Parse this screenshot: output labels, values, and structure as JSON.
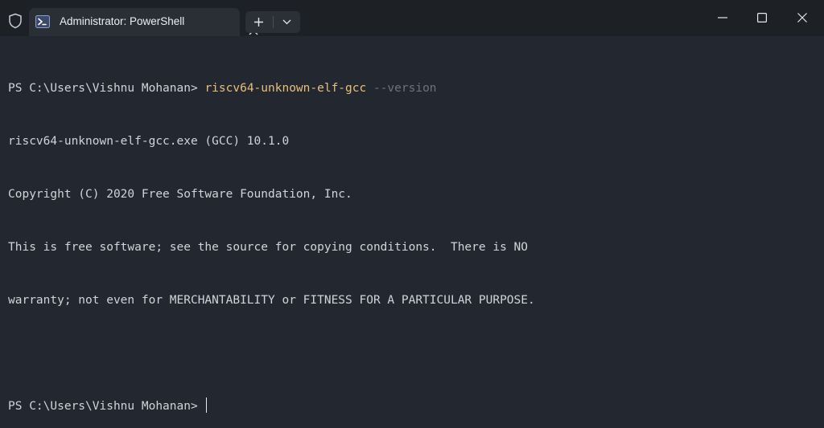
{
  "titlebar": {
    "tab_title": "Administrator: PowerShell",
    "shield_icon": "shield-icon",
    "tab_icon": "powershell-icon",
    "new_tab_icon": "plus-icon",
    "dropdown_icon": "chevron-down-icon",
    "window_controls": [
      "minimize-icon",
      "maximize-icon",
      "close-icon"
    ]
  },
  "terminal": {
    "prompt1": "PS C:\\Users\\Vishnu Mohanan> ",
    "command": "riscv64-unknown-elf-gcc",
    "command_arg": " --version",
    "output": [
      "riscv64-unknown-elf-gcc.exe (GCC) 10.1.0",
      "Copyright (C) 2020 Free Software Foundation, Inc.",
      "This is free software; see the source for copying conditions.  There is NO",
      "warranty; not even for MERCHANTABILITY or FITNESS FOR A PARTICULAR PURPOSE."
    ],
    "prompt2": "PS C:\\Users\\Vishnu Mohanan> "
  },
  "colors": {
    "background": "#232830",
    "titlebar": "#1d2025",
    "command": "#e8c07a",
    "argument": "#6b737d",
    "text": "#cfd4da"
  }
}
